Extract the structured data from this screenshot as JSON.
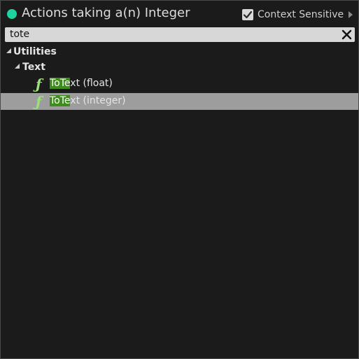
{
  "header": {
    "title": "Actions taking a(n) Integer",
    "pin_color": "#1ed3a0",
    "context_sensitive": {
      "label": "Context Sensitive",
      "checked": true
    }
  },
  "search": {
    "value": "tote"
  },
  "tree": {
    "category": "Utilities",
    "subcategory": "Text",
    "items": [
      {
        "match": "ToTe",
        "rest": "xt (float)",
        "icon": "function-icon",
        "selected": false
      },
      {
        "match": "ToTe",
        "rest": "xt (integer)",
        "icon": "function-icon",
        "selected": true
      }
    ]
  },
  "colors": {
    "highlight": "#3d8c1c",
    "selected_row": "#9d9d9d",
    "function_icon": "#9ce07c"
  }
}
